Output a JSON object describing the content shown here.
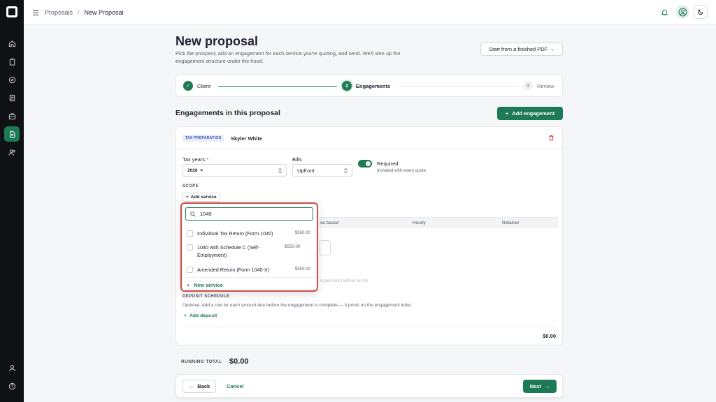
{
  "breadcrumb": {
    "parent": "Proposals",
    "separator": "/",
    "current": "New Proposal"
  },
  "header": {
    "title": "New proposal",
    "subtitle": "Pick the prospect, add an engagement for each service you're quoting, and send. We'll wire up the engagement structure under the hood.",
    "pdf_button": "Start from a finished PDF →"
  },
  "stepper": {
    "steps": [
      {
        "number": "✓",
        "label": "Client",
        "state": "done"
      },
      {
        "number": "2",
        "label": "Engagements",
        "state": "current"
      },
      {
        "number": "3",
        "label": "Review",
        "state": "upcoming"
      }
    ]
  },
  "engagements": {
    "title": "Engagements in this proposal",
    "add_button": "Add engagement"
  },
  "card": {
    "badge": "TAX PREPARATION",
    "client": "Skyler White",
    "tax_years_label": "Tax years",
    "required_mark": "*",
    "tax_year_chip": "2026",
    "bills_label": "Bills",
    "bills_value": "Upfront",
    "required_toggle_label": "Required",
    "required_toggle_sub": "Included with every quote",
    "scope_label": "SCOPE",
    "add_service": "Add service",
    "pricing_cols": [
      "se based",
      "Hourly",
      "Retainer"
    ],
    "faded_line1": "a payment method on file",
    "deposit_label": "DEPOSIT SCHEDULE",
    "deposit_desc": "Optional. Add a row for each amount due before the engagement is complete — it prints on the engagement letter.",
    "add_deposit": "Add deposit",
    "total": "$0.00"
  },
  "running_total": {
    "label": "RUNNING TOTAL",
    "value": "$0.00"
  },
  "footer": {
    "back": "Back",
    "cancel": "Cancel",
    "next": "Next"
  },
  "service_search": {
    "query": "1040",
    "options": [
      {
        "name": "Individual Tax Return (Form 1040)",
        "price": "$350.00"
      },
      {
        "name": "1040 with Schedule C (Self-Employment)",
        "price": "$550.00"
      },
      {
        "name": "Amended Return (Form 1040-X)",
        "price": "$350.00"
      }
    ],
    "new_service": "New service"
  },
  "colors": {
    "accent": "#1e7a55",
    "danger": "#c53a36",
    "highlight_border": "#d14a43"
  }
}
